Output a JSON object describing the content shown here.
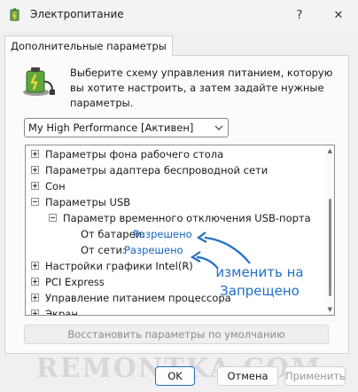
{
  "window": {
    "title": "Электропитание",
    "help": "?",
    "close": "✕"
  },
  "tab": {
    "label": "Дополнительные параметры"
  },
  "intro": {
    "text": "Выберите схему управления питанием, которую вы хотите настроить, а затем задайте нужные параметры."
  },
  "plan": {
    "selected": "My High Performance [Активен]"
  },
  "tree": {
    "items": [
      {
        "label": "Параметры фона рабочего стола",
        "state": "collapsed"
      },
      {
        "label": "Параметры адаптера беспроводной сети",
        "state": "collapsed"
      },
      {
        "label": "Сон",
        "state": "collapsed"
      },
      {
        "label": "Параметры USB",
        "state": "expanded"
      },
      {
        "label": "Параметр временного отключения USB-порта",
        "state": "expanded"
      },
      {
        "label": "От батареи:",
        "value": "Разрешено"
      },
      {
        "label": "От сети:",
        "value": "Разрешено"
      },
      {
        "label": "Настройки графики Intel(R)",
        "state": "collapsed"
      },
      {
        "label": "PCI Express",
        "state": "collapsed"
      },
      {
        "label": "Управление питанием процессора",
        "state": "collapsed"
      },
      {
        "label": "Экран",
        "state": "collapsed"
      }
    ]
  },
  "restore": {
    "label": "Восстановить параметры по умолчанию"
  },
  "annotation": {
    "line1": "изменить на",
    "line2": "Запрещено"
  },
  "watermark": {
    "text": "REMONTKA.COM"
  },
  "buttons": {
    "ok": "OK",
    "cancel": "Отмена",
    "apply": "Применить"
  },
  "colors": {
    "link": "#1464c0",
    "annotation": "#1f6fc7",
    "accent": "#1f6fc7"
  }
}
